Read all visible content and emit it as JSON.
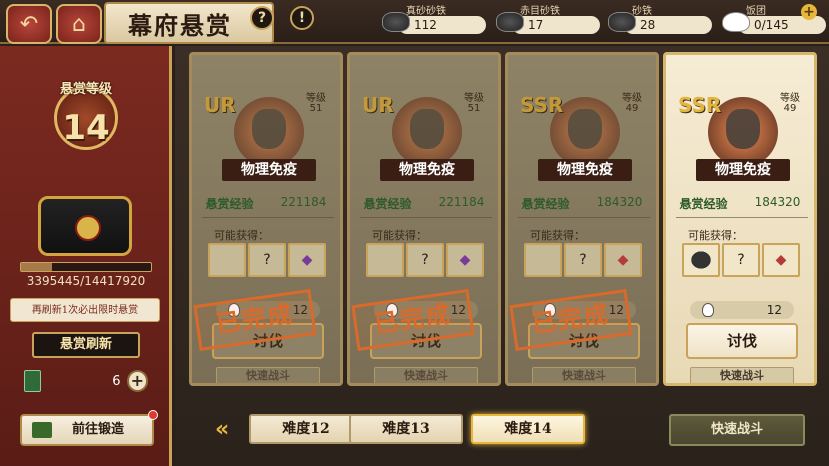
{
  "header": {
    "title": "幕府悬赏",
    "back_icon": "back-arrow-icon",
    "home_icon": "home-icon",
    "help_label": "?",
    "alert_label": "!"
  },
  "resources": [
    {
      "label": "真砂砂铁",
      "value": "112"
    },
    {
      "label": "赤目砂铁",
      "value": "17"
    },
    {
      "label": "砂铁",
      "value": "28"
    },
    {
      "label": "饭团",
      "value": "0/145"
    }
  ],
  "left": {
    "level_title": "悬赏等级",
    "level": "14",
    "progress_text": "3395445/14417920",
    "progress_fraction": 0.235,
    "note": "再刷新1次必出限时悬赏",
    "refresh_label": "悬赏刷新",
    "token_count": "6",
    "add_label": "+",
    "forge_label": "前往锻造"
  },
  "cards": [
    {
      "rarity": "UR",
      "grade_label": "等级",
      "grade": "51",
      "trait": "物理免疫",
      "exp_label": "悬赏经验",
      "exp": "221184",
      "rewards_label": "可能获得：",
      "rewards": [
        "",
        "?",
        ""
      ],
      "cost": "12",
      "hunt_label": "讨伐",
      "quick_label": "快速战斗",
      "stamp": "已完成"
    },
    {
      "rarity": "UR",
      "grade_label": "等级",
      "grade": "51",
      "trait": "物理免疫",
      "exp_label": "悬赏经验",
      "exp": "221184",
      "rewards_label": "可能获得：",
      "rewards": [
        "",
        "?",
        ""
      ],
      "cost": "12",
      "hunt_label": "讨伐",
      "quick_label": "快速战斗",
      "stamp": "已完成"
    },
    {
      "rarity": "SSR",
      "grade_label": "等级",
      "grade": "49",
      "trait": "物理免疫",
      "exp_label": "悬赏经验",
      "exp": "184320",
      "rewards_label": "可能获得：",
      "rewards": [
        "",
        "?",
        ""
      ],
      "cost": "12",
      "hunt_label": "讨伐",
      "quick_label": "快速战斗",
      "stamp": "已完成"
    },
    {
      "rarity": "SSR",
      "grade_label": "等级",
      "grade": "49",
      "trait": "物理免疫",
      "exp_label": "悬赏经验",
      "exp": "184320",
      "rewards_label": "可能获得：",
      "rewards": [
        "",
        "?",
        ""
      ],
      "cost": "12",
      "hunt_label": "讨伐",
      "quick_label": "快速战斗"
    }
  ],
  "difficulty": {
    "tabs": [
      "难度12",
      "难度13",
      "难度14"
    ],
    "selected": "难度14",
    "quick_battle": "快速战斗"
  },
  "colors": {
    "accent_gold": "#c9a35a",
    "panel_red": "#7c2a20",
    "stamp_orange": "#d96a2a"
  }
}
